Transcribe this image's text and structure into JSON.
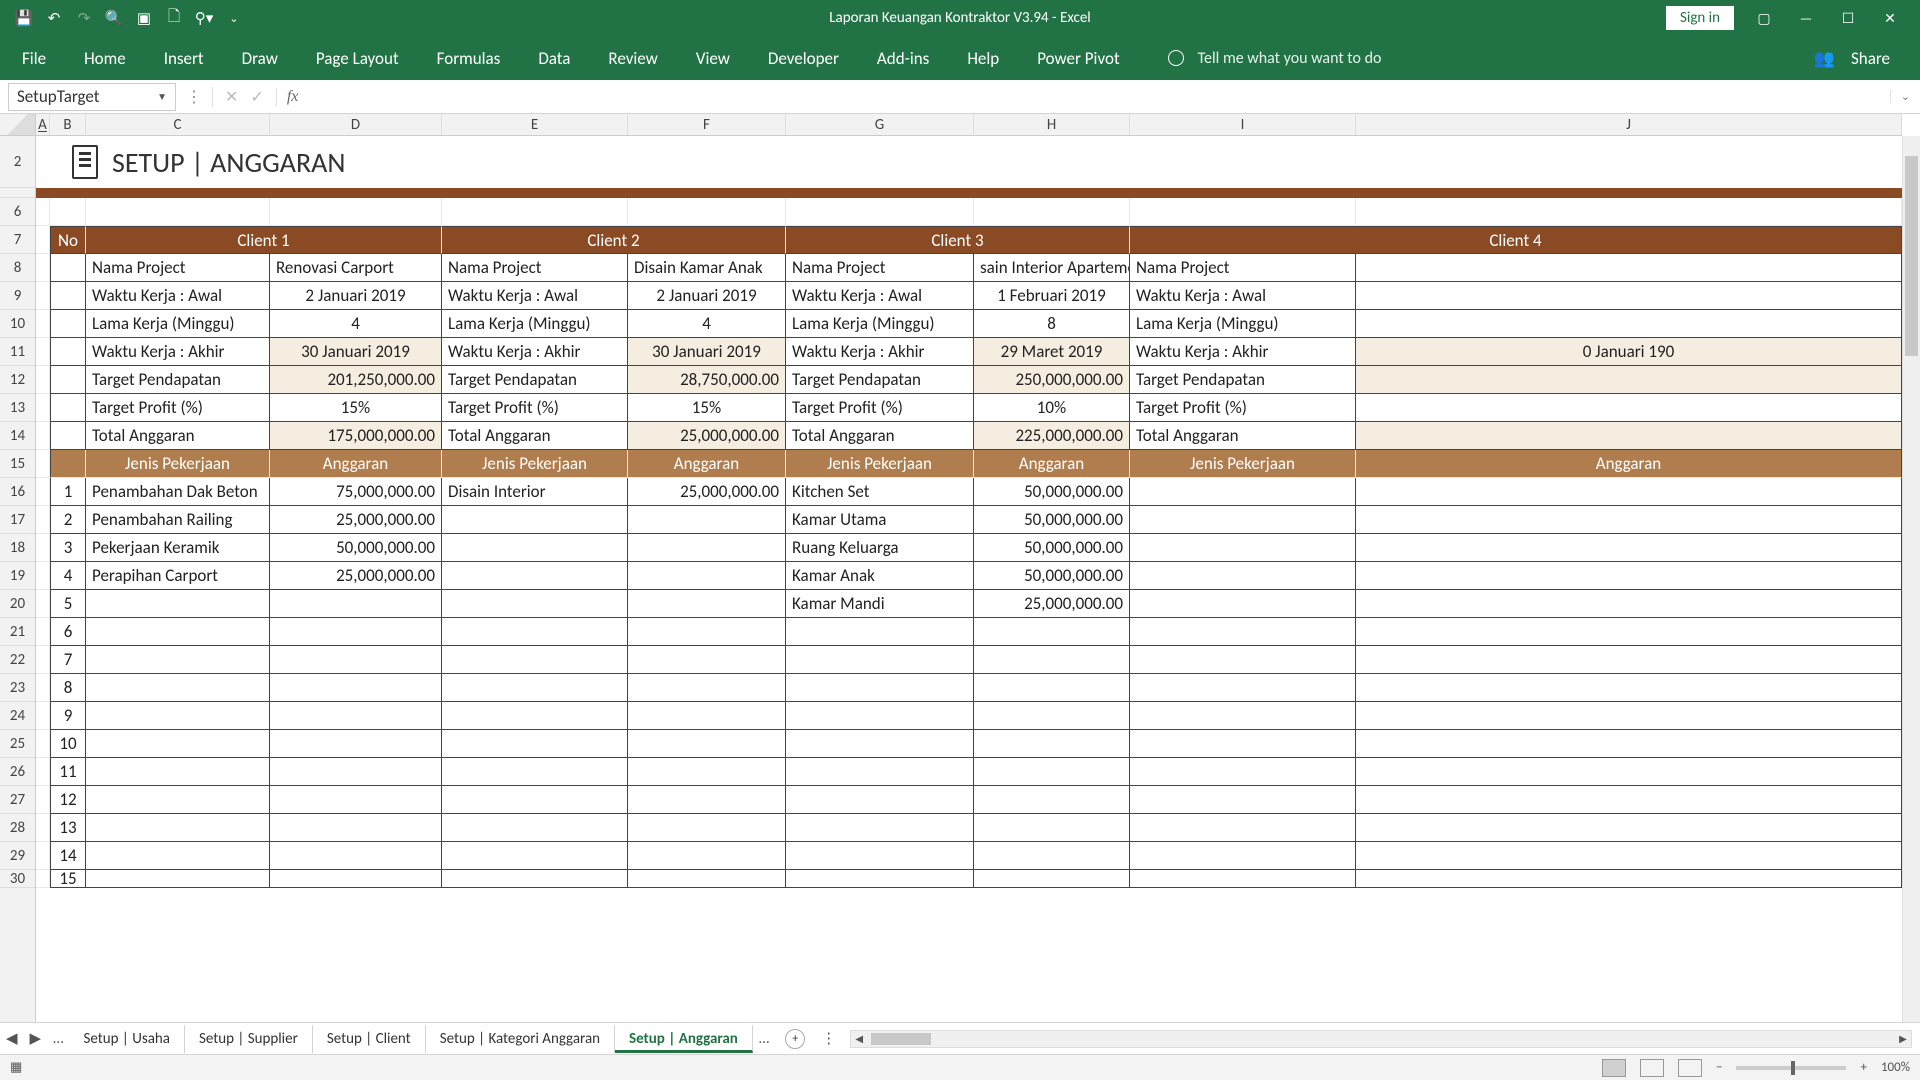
{
  "app": {
    "title": "Laporan Keuangan Kontraktor V3.94  -  Excel",
    "signin": "Sign in"
  },
  "ribbon": {
    "tabs": [
      "File",
      "Home",
      "Insert",
      "Draw",
      "Page Layout",
      "Formulas",
      "Data",
      "Review",
      "View",
      "Developer",
      "Add-ins",
      "Help",
      "Power Pivot"
    ],
    "tellme": "Tell me what you want to do",
    "share": "Share"
  },
  "namebox": "SetupTarget",
  "cols": [
    "A",
    "B",
    "C",
    "D",
    "E",
    "F",
    "G",
    "H",
    "I",
    "J"
  ],
  "rows": [
    "2",
    "",
    "6",
    "7",
    "8",
    "9",
    "10",
    "11",
    "12",
    "13",
    "14",
    "15",
    "16",
    "17",
    "18",
    "19",
    "20",
    "21",
    "22",
    "23",
    "24",
    "25",
    "26",
    "27",
    "28",
    "29",
    "30"
  ],
  "page_title": "SETUP | ANGGARAN",
  "hdr": {
    "no": "No",
    "c1": "Client 1",
    "c2": "Client 2",
    "c3": "Client 3",
    "c4": "Client 4",
    "jp": "Jenis Pekerjaan",
    "ang": "Anggaran"
  },
  "labels": {
    "nama": "Nama Project",
    "awal": "Waktu Kerja : Awal",
    "lama": "Lama Kerja (Minggu)",
    "akhir": "Waktu Kerja : Akhir",
    "pend": "Target Pendapatan",
    "profit": "Target Profit (%)",
    "total": "Total Anggaran"
  },
  "clients": [
    {
      "nama": "Renovasi Carport",
      "awal": "2 Januari 2019",
      "lama": "4",
      "akhir": "30 Januari 2019",
      "pend": "201,250,000.00",
      "profit": "15%",
      "total": "175,000,000.00",
      "jobs": [
        [
          "Penambahan Dak Beton",
          "75,000,000.00"
        ],
        [
          "Penambahan Railing",
          "25,000,000.00"
        ],
        [
          "Pekerjaan Keramik",
          "50,000,000.00"
        ],
        [
          "Perapihan Carport",
          "25,000,000.00"
        ]
      ]
    },
    {
      "nama": "Disain Kamar Anak",
      "awal": "2 Januari 2019",
      "lama": "4",
      "akhir": "30 Januari 2019",
      "pend": "28,750,000.00",
      "profit": "15%",
      "total": "25,000,000.00",
      "jobs": [
        [
          "Disain Interior",
          "25,000,000.00"
        ]
      ]
    },
    {
      "nama": "sain Interior Aparteme",
      "awal": "1 Februari 2019",
      "lama": "8",
      "akhir": "29 Maret 2019",
      "pend": "250,000,000.00",
      "profit": "10%",
      "total": "225,000,000.00",
      "jobs": [
        [
          "Kitchen Set",
          "50,000,000.00"
        ],
        [
          "Kamar Utama",
          "50,000,000.00"
        ],
        [
          "Ruang Keluarga",
          "50,000,000.00"
        ],
        [
          "Kamar Anak",
          "50,000,000.00"
        ],
        [
          "Kamar Mandi",
          "25,000,000.00"
        ]
      ]
    },
    {
      "nama": "",
      "awal": "",
      "lama": "",
      "akhir": "0 Januari 190",
      "pend": "",
      "profit": "",
      "total": "",
      "jobs": []
    }
  ],
  "rownums": [
    "1",
    "2",
    "3",
    "4",
    "5",
    "6",
    "7",
    "8",
    "9",
    "10",
    "11",
    "12",
    "13",
    "14",
    "15"
  ],
  "tabs": [
    "Setup | Usaha",
    "Setup | Supplier",
    "Setup | Client",
    "Setup | Kategori Anggaran",
    "Setup | Anggaran"
  ],
  "active_tab": 4,
  "zoom": "100%"
}
